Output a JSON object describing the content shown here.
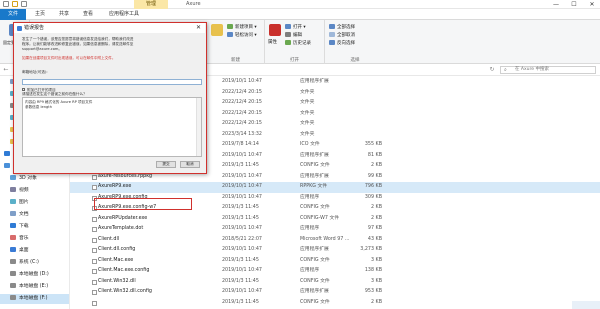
{
  "titlebar": {
    "context_tab": "管理",
    "title": "Axure",
    "minimize": "—",
    "maximize": "☐",
    "close": "✕"
  },
  "tabs": {
    "file": "文件",
    "home": "主页",
    "share": "共享",
    "view": "查看",
    "app_tools": "应用程序工具"
  },
  "ribbon": {
    "pin_label": "固定到快速访问",
    "new_group_label": "新建",
    "new_item": "新建项目 ▾",
    "easy_access": "轻松访问 ▾",
    "new_folder": "新建文件夹",
    "properties_label": "属性",
    "open_group_label": "打开",
    "open": "打开 ▾",
    "edit": "编辑",
    "history": "历史记录",
    "select_group_label": "选择",
    "select_all": "全部选择",
    "select_none": "全部取消",
    "invert": "反向选择"
  },
  "address": {
    "search_placeholder": "在 Axure 中搜索"
  },
  "nav": {
    "items": [
      {
        "label": "文档",
        "icon": "document-icon"
      },
      {
        "label": "图片",
        "icon": "picture-icon"
      },
      {
        "label": "本地磁盘",
        "icon": "drive-icon"
      },
      {
        "label": "图片",
        "icon": "picture-icon"
      },
      {
        "label": "欧洲",
        "icon": "folder-icon"
      },
      {
        "label": "中东",
        "icon": "folder-icon"
      },
      {
        "label": "OneDrive",
        "icon": "cloud-icon"
      },
      {
        "label": "此电脑",
        "icon": "computer-icon"
      },
      {
        "label": "3D 对象",
        "icon": "cube-icon"
      },
      {
        "label": "视频",
        "icon": "video-icon"
      },
      {
        "label": "图片",
        "icon": "picture-icon"
      },
      {
        "label": "文档",
        "icon": "document-icon"
      },
      {
        "label": "下载",
        "icon": "download-icon"
      },
      {
        "label": "音乐",
        "icon": "music-icon"
      },
      {
        "label": "桌面",
        "icon": "desktop-icon"
      },
      {
        "label": "系统 (C:)",
        "icon": "drive-icon"
      },
      {
        "label": "本地磁盘 (D:)",
        "icon": "drive-icon"
      },
      {
        "label": "本地磁盘 (E:)",
        "icon": "drive-icon"
      },
      {
        "label": "本地磁盘 (F:)",
        "icon": "drive-icon"
      }
    ]
  },
  "files": [
    {
      "name": "",
      "date": "2019/10/1 10:47",
      "type": "应用程序扩展",
      "size": ""
    },
    {
      "name": "",
      "date": "2022/12/4 20:15",
      "type": "文件夹",
      "size": ""
    },
    {
      "name": "",
      "date": "2022/12/4 20:15",
      "type": "文件夹",
      "size": ""
    },
    {
      "name": "",
      "date": "2022/12/4 20:15",
      "type": "文件夹",
      "size": ""
    },
    {
      "name": "",
      "date": "2022/12/4 20:15",
      "type": "文件夹",
      "size": ""
    },
    {
      "name": "",
      "date": "2023/3/14 13:32",
      "type": "文件夹",
      "size": ""
    },
    {
      "name": "",
      "date": "2019/7/8 14:14",
      "type": "ICO 文件",
      "size": "355 KB"
    },
    {
      "name": "AxDoc.dll.config",
      "date": "2019/10/1 10:47",
      "type": "应用程序扩展",
      "size": "81 KB"
    },
    {
      "name": "AxImageMagick.dll",
      "date": "2019/1/3 11:45",
      "type": "CONFIG 文件",
      "size": "2 KB"
    },
    {
      "name": "axure-resources.rppkg",
      "date": "2019/10/1 10:47",
      "type": "应用程序扩展",
      "size": "99 KB"
    },
    {
      "name": "AxureRP9.exe",
      "date": "2019/10/1 10:47",
      "type": "RPPKG 文件",
      "size": "796 KB"
    },
    {
      "name": "AxureRP9.exe.config",
      "date": "2019/10/1 10:47",
      "type": "应用程序",
      "size": "309 KB"
    },
    {
      "name": "AxureRP9.exe.config-w7",
      "date": "2019/1/3 11:45",
      "type": "CONFIG 文件",
      "size": "2 KB"
    },
    {
      "name": "AxureRPUpdater.exe",
      "date": "2019/1/3 11:45",
      "type": "CONFIG-W7 文件",
      "size": "2 KB"
    },
    {
      "name": "AxureTemplate.dot",
      "date": "2019/10/1 10:47",
      "type": "应用程序",
      "size": "97 KB"
    },
    {
      "name": "Client.dll",
      "date": "2018/5/21 22:07",
      "type": "Microsoft Word 97 ...",
      "size": "43 KB"
    },
    {
      "name": "Client.dll.config",
      "date": "2019/10/1 10:47",
      "type": "应用程序扩展",
      "size": "3,273 KB"
    },
    {
      "name": "Client.Mac.exe",
      "date": "2019/1/3 11:45",
      "type": "CONFIG 文件",
      "size": "3 KB"
    },
    {
      "name": "Client.Mac.exe.config",
      "date": "2019/10/1 10:47",
      "type": "应用程序",
      "size": "138 KB"
    },
    {
      "name": "Client.Win32.dll",
      "date": "2019/1/3 11:45",
      "type": "CONFIG 文件",
      "size": "3 KB"
    },
    {
      "name": "Client.Win32.dll.config",
      "date": "2019/10/1 10:47",
      "type": "应用程序扩展",
      "size": "953 KB"
    },
    {
      "name": "",
      "date": "2019/1/3 11:45",
      "type": "CONFIG 文件",
      "size": "2 KB"
    }
  ],
  "dialog": {
    "title": "错误报告",
    "close": "✕",
    "text1": "发生了一个错误，该是否您愿意将错误信息发送给我们，帮助我们改进",
    "text2": "程序。让我们能够改进和修复此错误，如果信息被删除，请发送邮件至",
    "text3": "support@axure.com。",
    "red_text": "如果在创建项目文件时出现错误，可以在邮件中附上文件。",
    "email_label": "邮箱地址(可选):",
    "email_value": "",
    "checkbox_label": "附加已打开的项目",
    "desc_label": "请描述在发生这个错误之前你在做什么？",
    "area_line1": "内容由 RP9 格式化的 Axure RP 项目文件",
    "area_line2": "参数信息 length",
    "send": "提交",
    "cancel": "取消"
  },
  "colors": {
    "accent": "#1979ca",
    "highlight": "#d0312d",
    "context_tab": "#fbe7a6"
  }
}
